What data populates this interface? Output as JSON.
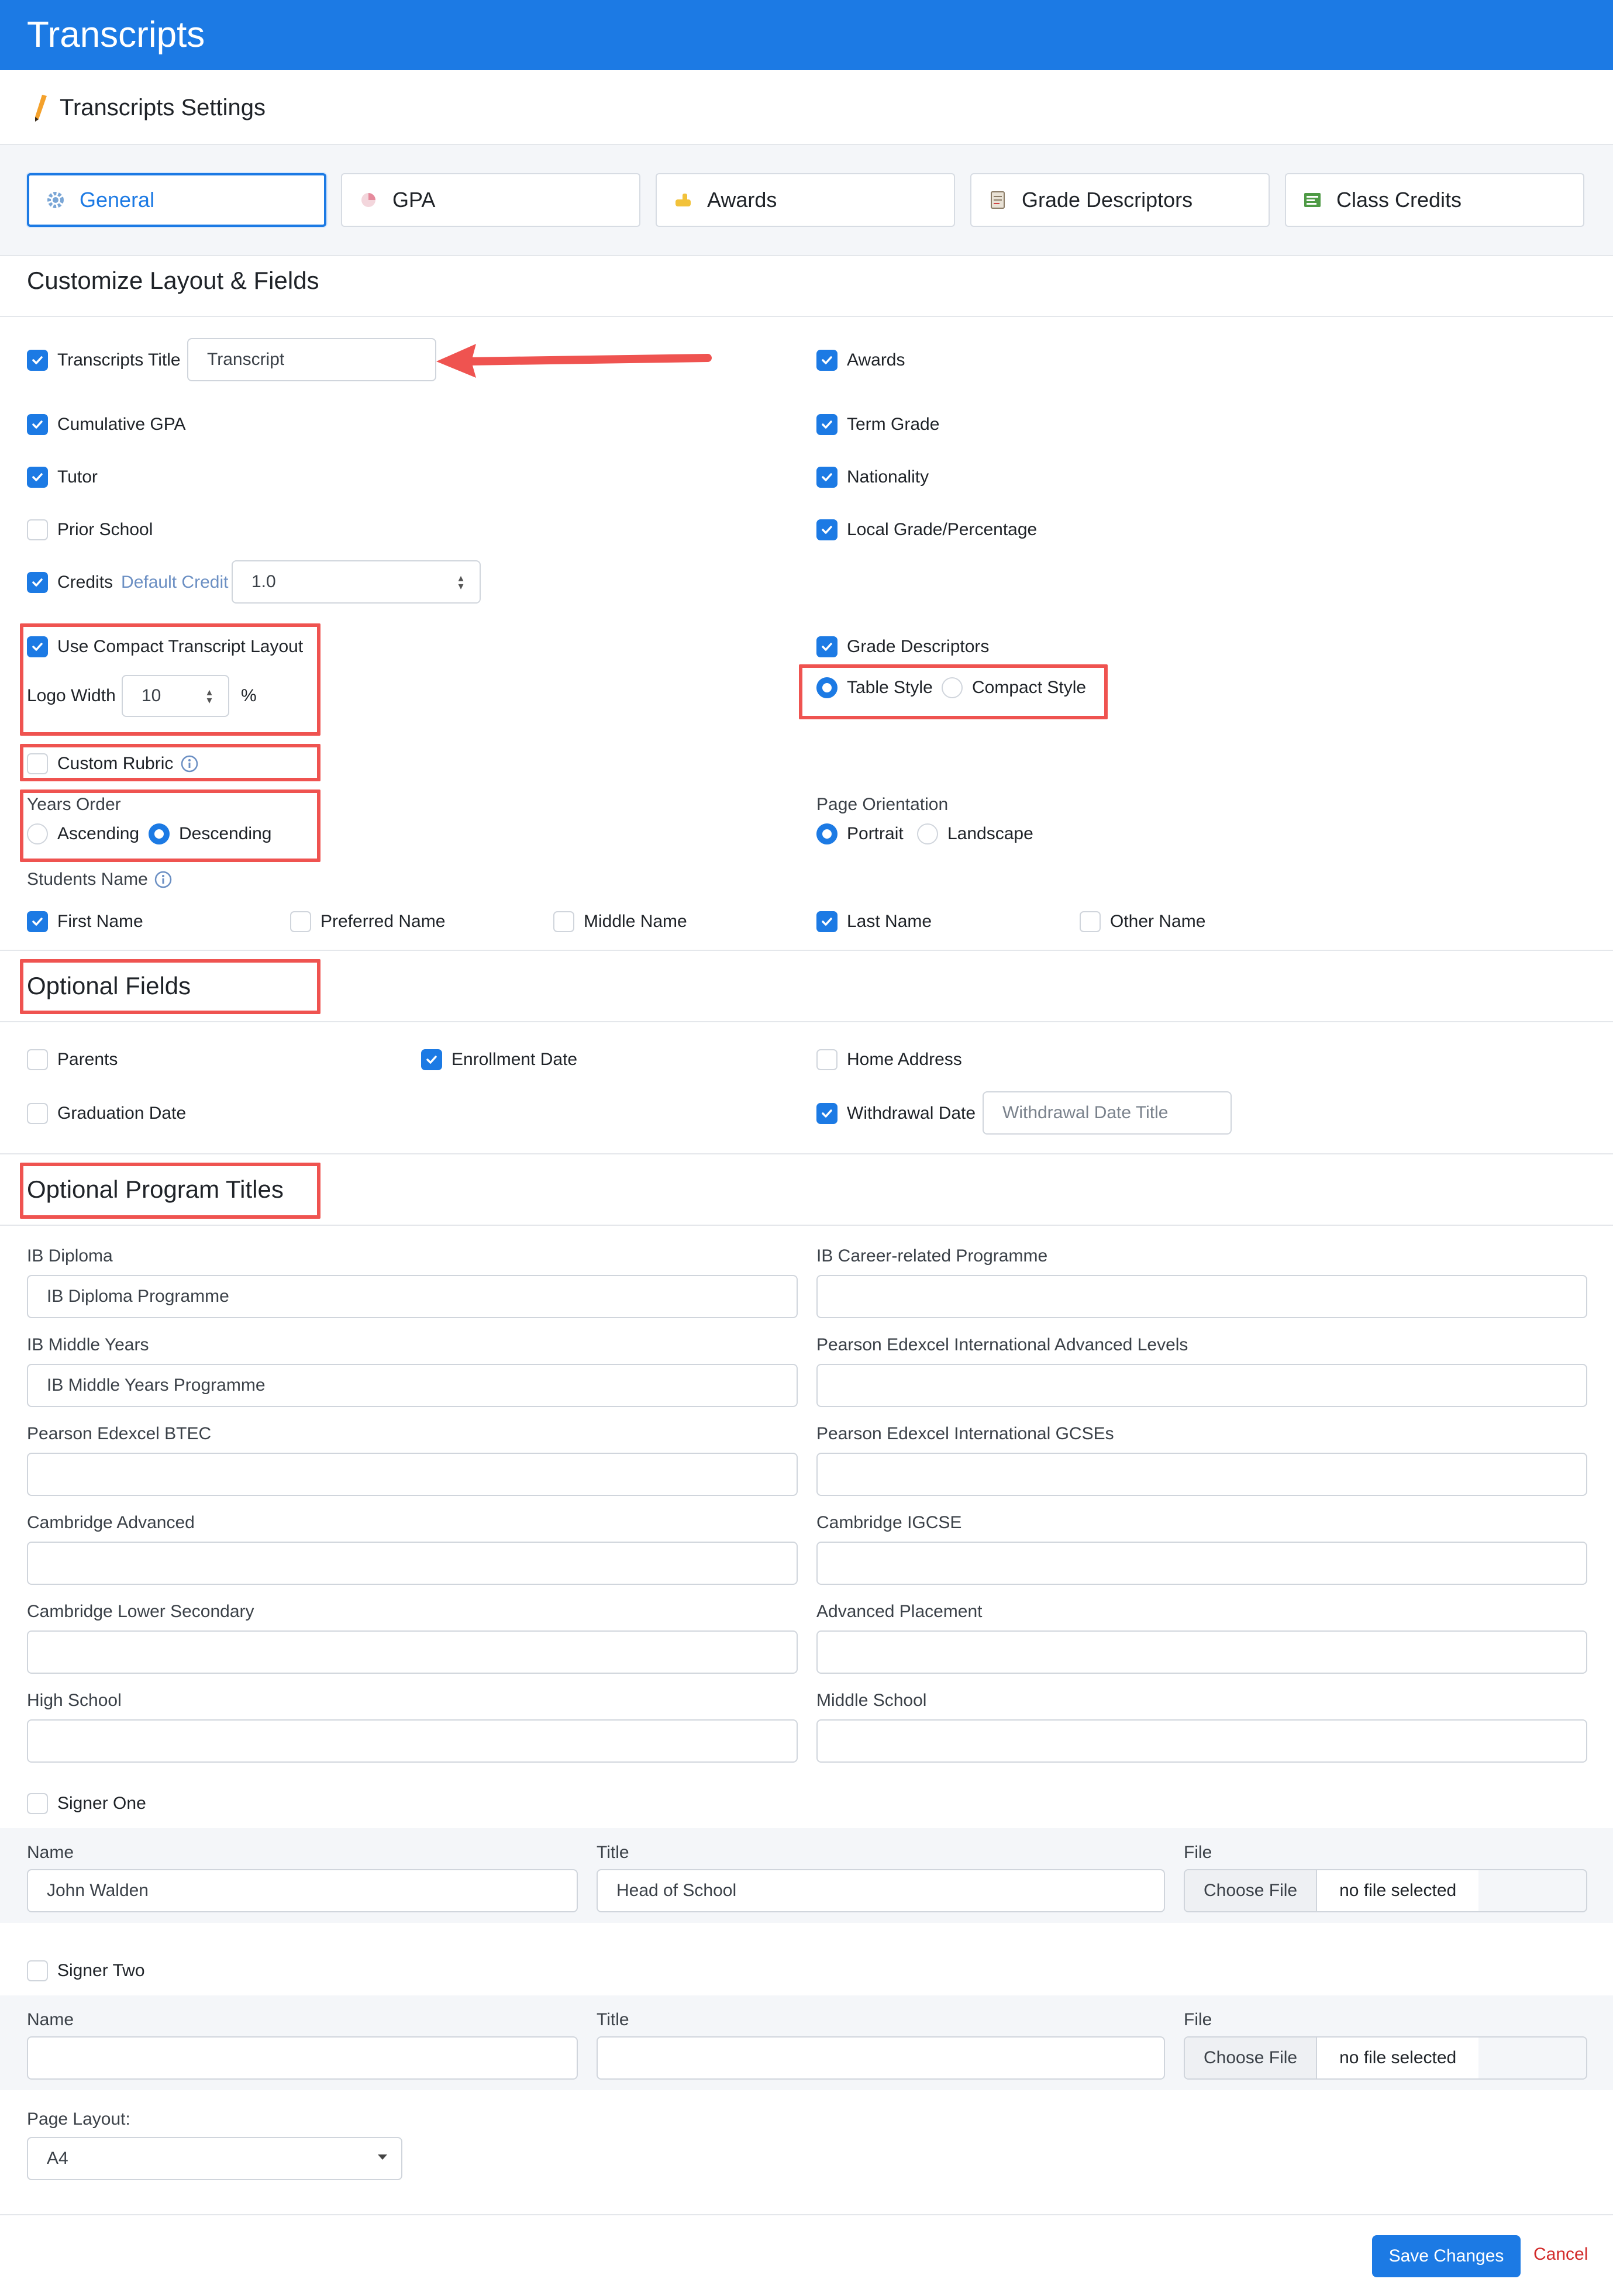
{
  "header": {
    "title": "Transcripts"
  },
  "subheader": {
    "title": "Transcripts Settings"
  },
  "tabs": [
    {
      "label": "General",
      "active": true,
      "icon": "gear-icon"
    },
    {
      "label": "GPA",
      "active": false,
      "icon": "chart-icon"
    },
    {
      "label": "Awards",
      "active": false,
      "icon": "thumbs-up-icon"
    },
    {
      "label": "Grade Descriptors",
      "active": false,
      "icon": "document-icon"
    },
    {
      "label": "Class Credits",
      "active": false,
      "icon": "ledger-icon"
    }
  ],
  "layout": {
    "title": "Customize Layout & Fields",
    "transcripts_title": {
      "label": "Transcripts Title",
      "checked": true,
      "value": "Transcript"
    },
    "awards": {
      "label": "Awards",
      "checked": true
    },
    "cumulative_gpa": {
      "label": "Cumulative GPA",
      "checked": true
    },
    "term_grade": {
      "label": "Term Grade",
      "checked": true
    },
    "tutor": {
      "label": "Tutor",
      "checked": true
    },
    "nationality": {
      "label": "Nationality",
      "checked": true
    },
    "prior_school": {
      "label": "Prior School",
      "checked": false
    },
    "local_grade": {
      "label": "Local Grade/Percentage",
      "checked": true
    },
    "credits": {
      "label": "Credits",
      "checked": true,
      "default_label": "Default Credit",
      "value": "1.0"
    },
    "compact_layout": {
      "label": "Use Compact Transcript Layout",
      "checked": true
    },
    "logo_width": {
      "label": "Logo Width",
      "value": "10",
      "unit": "%"
    },
    "grade_descriptors": {
      "label": "Grade Descriptors",
      "checked": true
    },
    "table_style": {
      "label": "Table Style",
      "selected": true
    },
    "compact_style": {
      "label": "Compact Style",
      "selected": false
    },
    "custom_rubric": {
      "label": "Custom Rubric",
      "checked": false
    },
    "years_order": {
      "label": "Years Order",
      "ascending": "Ascending",
      "descending": "Descending",
      "selected": "Descending"
    },
    "page_orientation": {
      "label": "Page Orientation",
      "portrait": "Portrait",
      "landscape": "Landscape",
      "selected": "Portrait"
    },
    "students_name": {
      "label": "Students Name",
      "options": [
        {
          "label": "First Name",
          "checked": true
        },
        {
          "label": "Preferred Name",
          "checked": false
        },
        {
          "label": "Middle Name",
          "checked": false
        },
        {
          "label": "Last Name",
          "checked": true
        },
        {
          "label": "Other Name",
          "checked": false
        }
      ]
    }
  },
  "optional_fields": {
    "title": "Optional Fields",
    "parents": {
      "label": "Parents",
      "checked": false
    },
    "enrollment_date": {
      "label": "Enrollment Date",
      "checked": true
    },
    "home_address": {
      "label": "Home Address",
      "checked": false
    },
    "graduation_date": {
      "label": "Graduation Date",
      "checked": false
    },
    "withdrawal_date": {
      "label": "Withdrawal Date",
      "checked": true,
      "placeholder": "Withdrawal Date Title"
    }
  },
  "program_titles": {
    "title": "Optional Program Titles",
    "fields": [
      {
        "label": "IB Diploma",
        "value": "IB Diploma Programme"
      },
      {
        "label": "IB Career-related Programme",
        "value": ""
      },
      {
        "label": "IB Middle Years",
        "value": "IB Middle Years Programme"
      },
      {
        "label": "Pearson Edexcel International Advanced Levels",
        "value": ""
      },
      {
        "label": "Pearson Edexcel BTEC",
        "value": ""
      },
      {
        "label": "Pearson Edexcel International GCSEs",
        "value": ""
      },
      {
        "label": "Cambridge Advanced",
        "value": ""
      },
      {
        "label": "Cambridge IGCSE",
        "value": ""
      },
      {
        "label": "Cambridge Lower Secondary",
        "value": ""
      },
      {
        "label": "Advanced Placement",
        "value": ""
      },
      {
        "label": "High School",
        "value": ""
      },
      {
        "label": "Middle School",
        "value": ""
      }
    ]
  },
  "signers": [
    {
      "label": "Signer One",
      "checked": false,
      "name_label": "Name",
      "name": "John Walden",
      "title_label": "Title",
      "title": "Head of School",
      "file_label": "File",
      "choose": "Choose File",
      "file": "no file selected"
    },
    {
      "label": "Signer Two",
      "checked": false,
      "name_label": "Name",
      "name": "",
      "title_label": "Title",
      "title": "",
      "file_label": "File",
      "choose": "Choose File",
      "file": "no file selected"
    }
  ],
  "page_layout": {
    "label": "Page Layout:",
    "value": "A4"
  },
  "actions": {
    "save": "Save Changes",
    "cancel": "Cancel"
  },
  "colors": {
    "primary": "#1c7ae4",
    "annotation": "#ef5350",
    "cancel": "#d22a2a"
  }
}
